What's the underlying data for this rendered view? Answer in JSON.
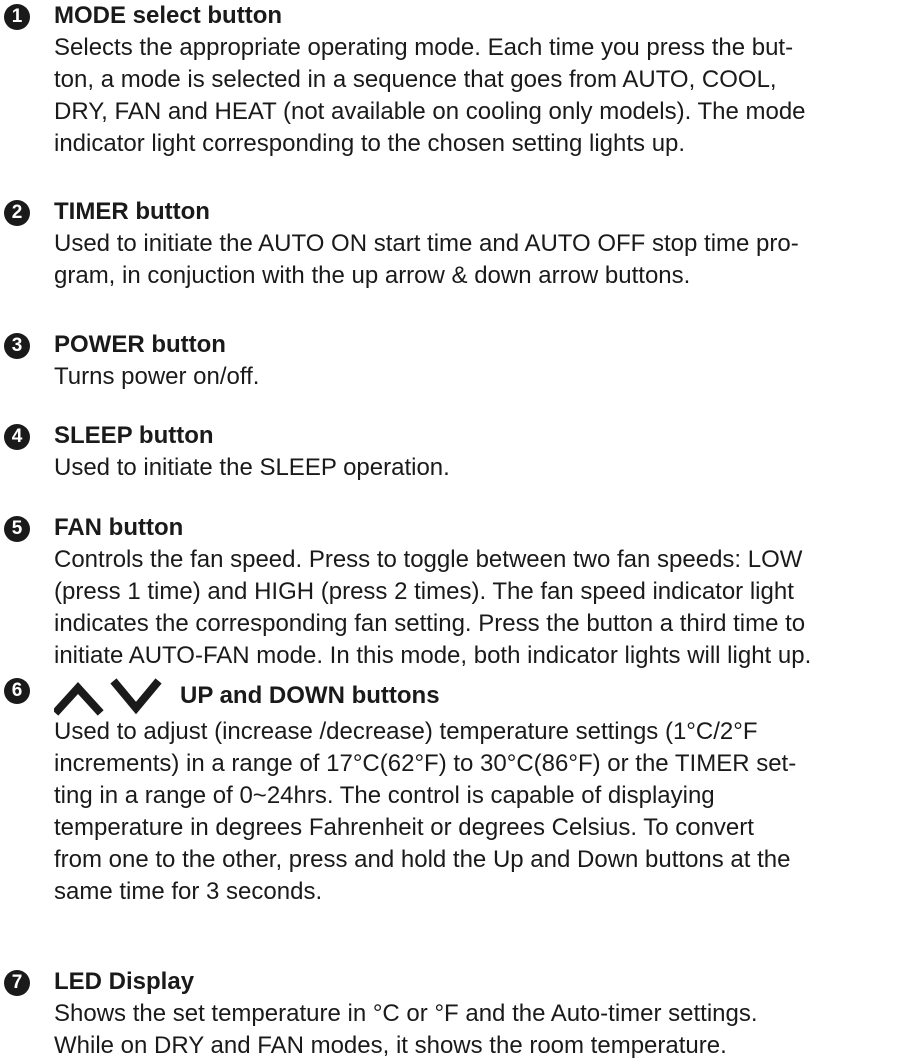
{
  "items": [
    {
      "number": "1",
      "title": "MODE select button",
      "body": "Selects the appropriate operating mode. Each time you press the but-\nton, a mode is selected in a sequence that goes from AUTO, COOL,\nDRY, FAN and HEAT (not available on cooling only models). The mode\nindicator light corresponding to the chosen setting lights up."
    },
    {
      "number": "2",
      "title": "TIMER button",
      "body": "Used to initiate the AUTO ON start time and AUTO OFF stop time pro-\ngram, in conjuction with the up arrow & down arrow buttons."
    },
    {
      "number": "3",
      "title": "POWER button",
      "body": "Turns power on/off."
    },
    {
      "number": "4",
      "title": "SLEEP button",
      "body": "Used to initiate the SLEEP operation."
    },
    {
      "number": "5",
      "title": "FAN button",
      "body": "Controls the fan speed. Press to toggle between two fan speeds: LOW\n(press 1 time) and HIGH (press 2 times). The fan speed indicator light\nindicates the corresponding fan setting. Press the button a third time to\ninitiate AUTO-FAN mode. In this mode, both indicator lights will light up."
    },
    {
      "number": "6",
      "title": "UP and DOWN buttons",
      "icons": [
        "up-arrow-icon",
        "down-arrow-icon"
      ],
      "body": "Used to adjust (increase /decrease) temperature settings (1°C/2°F\nincrements) in a range of 17°C(62°F) to 30°C(86°F) or the TIMER set-\nting in a range of 0~24hrs. The control is capable of displaying\ntemperature in degrees Fahrenheit or degrees Celsius. To convert\nfrom one to the other, press and hold the Up and Down buttons at the\nsame time for 3 seconds."
    },
    {
      "number": "7",
      "title": "LED Display",
      "body": "Shows the set temperature in °C or °F and the Auto-timer settings.\nWhile on DRY and FAN modes, it shows the room temperature."
    }
  ]
}
